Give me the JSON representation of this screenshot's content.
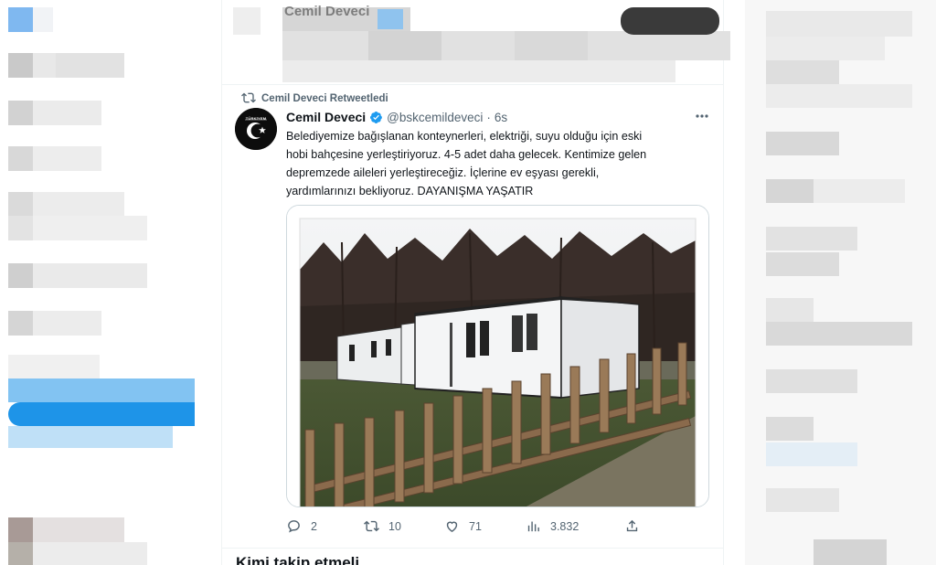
{
  "colors": {
    "accent": "#1d9bf0",
    "muted": "#536471",
    "text": "#0f1419",
    "border": "#cfd9de"
  },
  "header": {
    "partial_name": "Cemil Deveci"
  },
  "tweet": {
    "retweet_label": "Cemil Deveci Retweetledi",
    "display_name": "Cemil Deveci",
    "handle": "@bskcemildeveci",
    "separator": "·",
    "time": "6s",
    "text_lines": [
      "Belediyemize bağışlanan konteynerleri, elektriği, suyu olduğu için eski",
      "hobi bahçesine yerleştiriyoruz. 4-5 adet daha gelecek. Kentimize gelen",
      "depremzede aileleri yerleştireceğiz. İçlerine ev eşyası gerekli,",
      "yardımlarınızı bekliyoruz. DAYANIŞMA YAŞATIR"
    ],
    "avatar_label": "TÜRKİYEM",
    "replies": "2",
    "retweets": "10",
    "likes": "71",
    "views": "3.832",
    "icons": [
      "retweet-icon",
      "verified-badge-icon",
      "more-icon",
      "reply-icon",
      "retweet-icon",
      "like-icon",
      "views-icon",
      "share-icon"
    ]
  },
  "who_to_follow": {
    "title": "Kimi takip etmeli"
  }
}
